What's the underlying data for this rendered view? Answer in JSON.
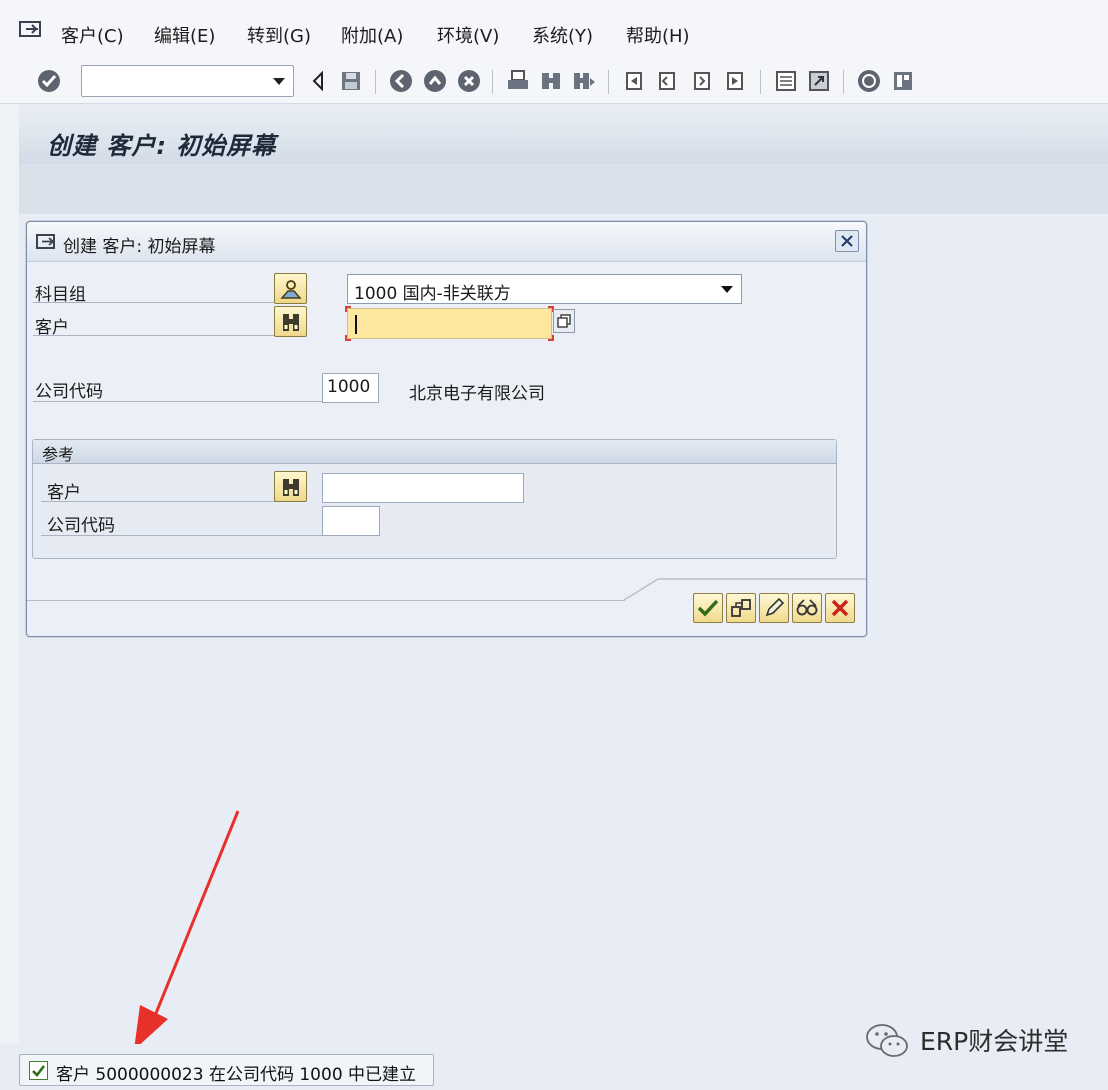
{
  "menu": {
    "items": [
      "客户(C)",
      "编辑(E)",
      "转到(G)",
      "附加(A)",
      "环境(V)",
      "系统(Y)",
      "帮助(H)"
    ]
  },
  "toolbar": {
    "command_field_value": "",
    "icons": [
      "enter-icon",
      "back-icon",
      "save-icon",
      "exit-icon",
      "cancel-icon",
      "print-icon",
      "find-icon",
      "find-next-icon",
      "first-page-icon",
      "prev-page-icon",
      "next-page-icon",
      "last-page-icon",
      "new-session-icon",
      "shortcut-icon",
      "help-icon",
      "layout-icon"
    ]
  },
  "screen": {
    "title": "创建 客户: 初始屏幕"
  },
  "dialog": {
    "title": "创建 客户: 初始屏幕",
    "fields": {
      "account_group_label": "科目组",
      "account_group_value": "1000 国内-非关联方",
      "customer_label": "客户",
      "customer_value": "",
      "company_code_label": "公司代码",
      "company_code_value": "1000",
      "company_name": "北京电子有限公司"
    },
    "reference": {
      "title": "参考",
      "customer_label": "客户",
      "customer_value": "",
      "company_code_label": "公司代码",
      "company_code_value": ""
    },
    "buttons": [
      "continue-icon",
      "org-levels-icon",
      "edit-icon",
      "display-icon",
      "cancel-icon"
    ]
  },
  "status": {
    "type": "success",
    "message": "客户 5000000023 在公司代码 1000 中已建立"
  },
  "watermark": {
    "text": "ERP财会讲堂"
  },
  "colors": {
    "required_field": "#fde79e",
    "title_bar": "#d3dce7",
    "annotation_arrow": "#e8302a"
  }
}
